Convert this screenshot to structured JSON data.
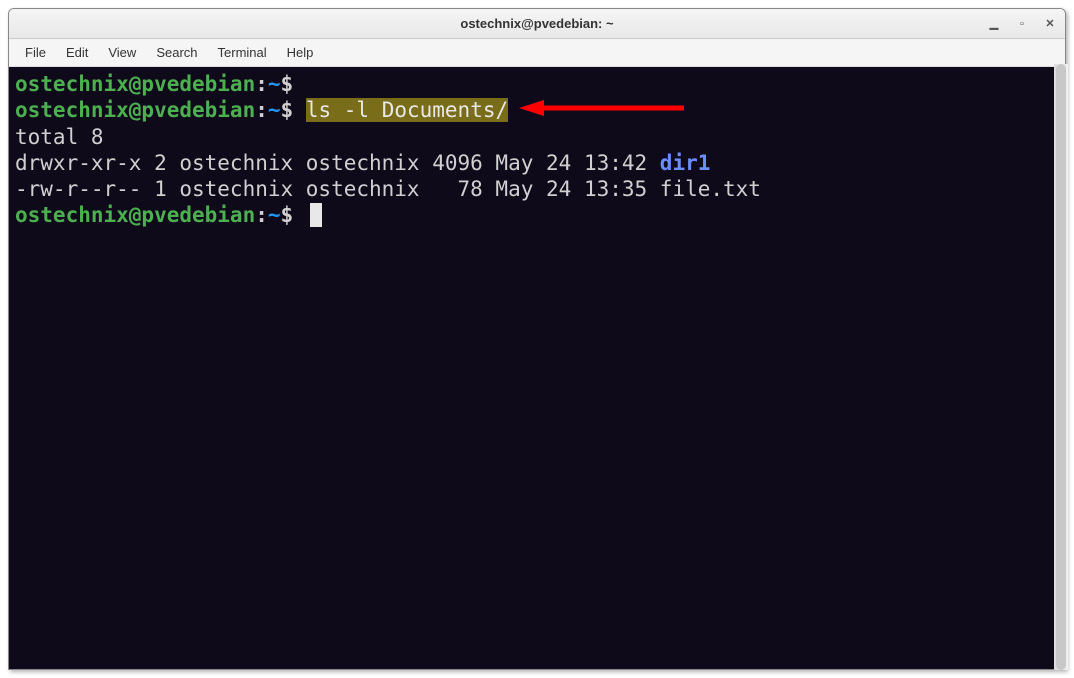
{
  "window": {
    "title": "ostechnix@pvedebian: ~"
  },
  "menubar": {
    "items": [
      "File",
      "Edit",
      "View",
      "Search",
      "Terminal",
      "Help"
    ]
  },
  "prompt": {
    "user_host": "ostechnix@pvedebian",
    "colon": ":",
    "path": "~",
    "dollar": "$"
  },
  "lines": {
    "cmd1_blank": "",
    "cmd2_text": "ls -l Documents/",
    "out_total": "total 8",
    "out_row1_pre": "drwxr-xr-x 2 ostechnix ostechnix 4096 May 24 13:42 ",
    "out_row1_dir": "dir1",
    "out_row2": "-rw-r--r-- 1 ostechnix ostechnix   78 May 24 13:35 file.txt"
  },
  "colors": {
    "arrow": "#ff0000"
  }
}
